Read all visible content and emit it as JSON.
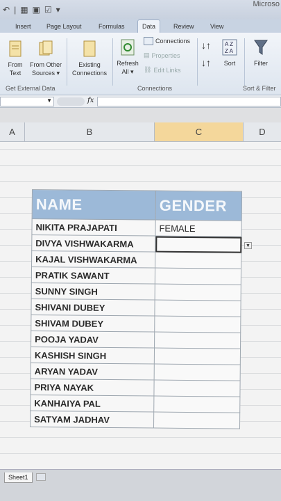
{
  "app": {
    "title": "Microso"
  },
  "tabs": [
    "Insert",
    "Page Layout",
    "Formulas",
    "Data",
    "Review",
    "View"
  ],
  "active_tab": "Data",
  "ribbon": {
    "from_text": [
      "From",
      "Text"
    ],
    "from_other": [
      "From Other",
      "Sources"
    ],
    "existing": [
      "Existing",
      "Connections"
    ],
    "refresh": [
      "Refresh",
      "All"
    ],
    "connections": "Connections",
    "properties": "Properties",
    "edit_links": "Edit Links",
    "sort": "Sort",
    "filter": "Filter",
    "group_external": "Get External Data",
    "group_connections": "Connections",
    "group_sort": "Sort & Filter"
  },
  "formula_bar": {
    "fx": "fx",
    "name_box": "",
    "content": ""
  },
  "columns": [
    "A",
    "B",
    "C",
    "D"
  ],
  "table": {
    "headers": [
      "NAME",
      "GENDER"
    ],
    "rows": [
      {
        "name": "NIKITA PRAJAPATI",
        "gender": "FEMALE"
      },
      {
        "name": "DIVYA  VISHWAKARMA",
        "gender": ""
      },
      {
        "name": "KAJAL VISHWAKARMA",
        "gender": ""
      },
      {
        "name": "PRATIK SAWANT",
        "gender": ""
      },
      {
        "name": "SUNNY SINGH",
        "gender": ""
      },
      {
        "name": "SHIVANI DUBEY",
        "gender": ""
      },
      {
        "name": "SHIVAM DUBEY",
        "gender": ""
      },
      {
        "name": "POOJA YADAV",
        "gender": ""
      },
      {
        "name": "KASHISH SINGH",
        "gender": ""
      },
      {
        "name": "ARYAN YADAV",
        "gender": ""
      },
      {
        "name": "PRIYA NAYAK",
        "gender": ""
      },
      {
        "name": "KANHAIYA PAL",
        "gender": ""
      },
      {
        "name": "SATYAM JADHAV",
        "gender": ""
      }
    ]
  },
  "sheet_tab": "Sheet1",
  "colors": {
    "header_fill": "#9cb9d8",
    "ribbon": "#dde5ef"
  }
}
